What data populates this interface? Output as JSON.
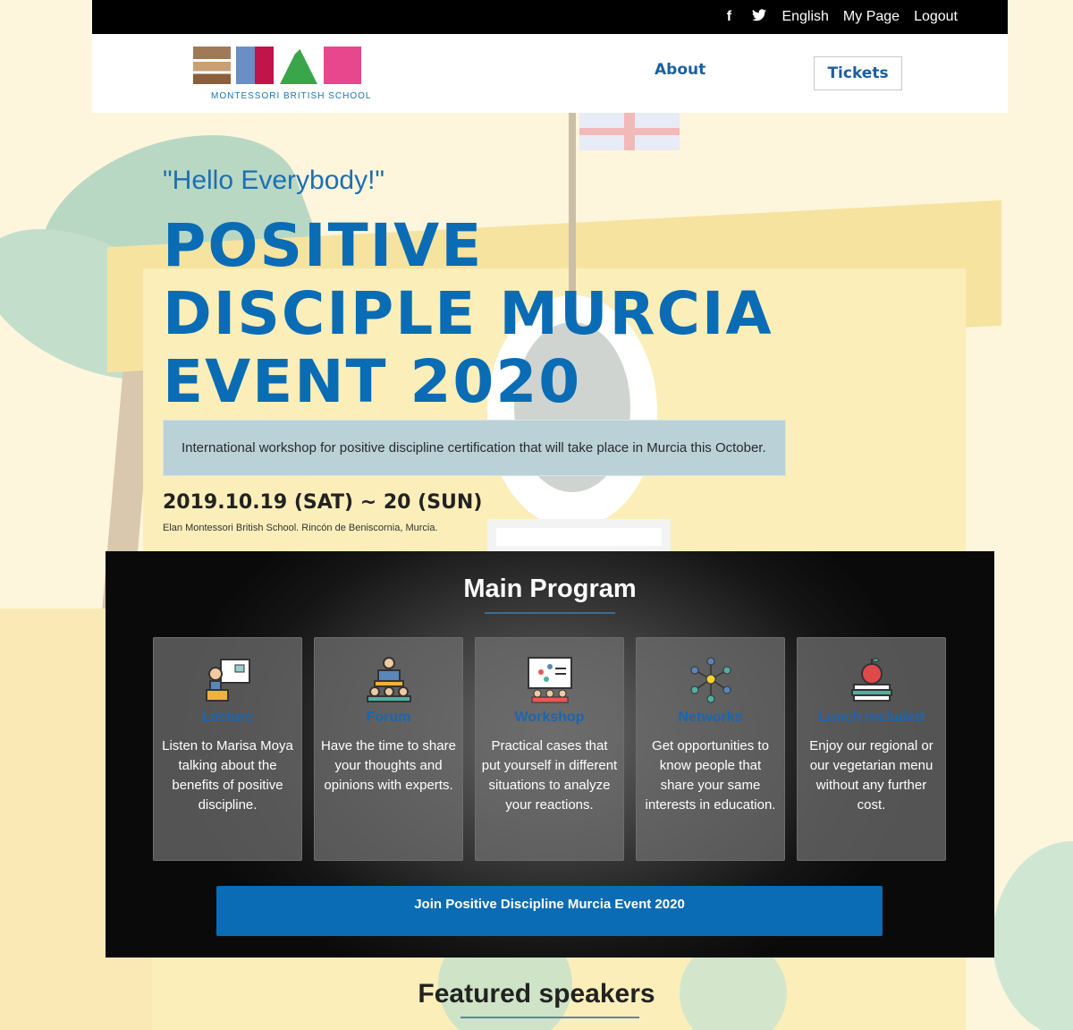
{
  "topbar": {
    "social": [
      {
        "name": "facebook-icon",
        "glyph": "f"
      },
      {
        "name": "twitter-icon",
        "glyph": "🐦"
      }
    ],
    "language": "English",
    "my_page": "My Page",
    "logout": "Logout"
  },
  "header": {
    "logo_text": "ELAN",
    "logo_tagline": "MONTESSORI BRITISH SCHOOL",
    "nav_about": "About",
    "nav_tickets": "Tickets"
  },
  "hero": {
    "greeting": "\"Hello Everybody!\"",
    "title": "POSITIVE DISCIPLE MURCIA EVENT 2020",
    "intro": "International workshop for positive discipline certification that will take place in Murcia this October.",
    "date": "2019.10.19 (SAT) ~ 20 (SUN)",
    "venue": "Elan Montessori British School. Rincón de Beniscornia, Murcia."
  },
  "program": {
    "heading": "Main Program",
    "cards": [
      {
        "title": "Lecture",
        "icon": "lecture-icon",
        "desc": "Listen to Marisa Moya talking about the benefits of positive discipline."
      },
      {
        "title": "Forum",
        "icon": "forum-icon",
        "desc": "Have the time to share your thoughts and opinions with experts."
      },
      {
        "title": "Workshop",
        "icon": "workshop-icon",
        "desc": "Practical cases that put yourself in different situations to analyze your reactions."
      },
      {
        "title": "Networks",
        "icon": "network-icon",
        "desc": "Get opportunities to know people that share your same interests in education."
      },
      {
        "title": "Lunch included",
        "icon": "apple-books-icon",
        "desc": "Enjoy our regional or our vegetarian menu without any further cost."
      }
    ],
    "join_button": "Join Positive Discipline Murcia Event 2020"
  },
  "featured": {
    "heading": "Featured speakers"
  },
  "colors": {
    "brand_blue": "#0a6cb4",
    "topbar": "#000000"
  }
}
